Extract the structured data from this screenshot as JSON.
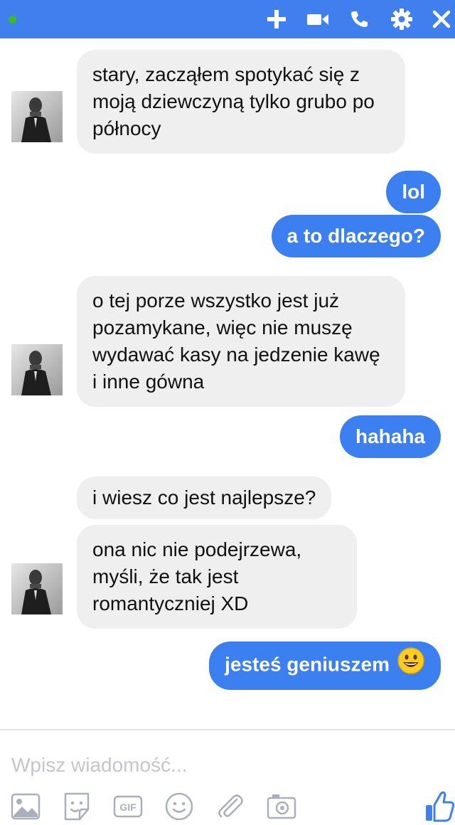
{
  "header": {
    "status": "online",
    "icons": [
      "add-icon",
      "video-call-icon",
      "phone-icon",
      "settings-icon",
      "close-icon"
    ],
    "accent_color": "#4080ee"
  },
  "conversation": {
    "messages": [
      {
        "from": "them",
        "text": "stary, zacząłem spotykać się z moją dziewczyną tylko grubo po północy"
      },
      {
        "from": "me",
        "text": "lol"
      },
      {
        "from": "me",
        "text": "a to dlaczego?"
      },
      {
        "from": "them",
        "text": "o tej porze wszystko jest już pozamykane, więc nie muszę wydawać kasy na jedzenie kawę i inne gówna"
      },
      {
        "from": "me",
        "text": "hahaha"
      },
      {
        "from": "them",
        "text": "i wiesz co jest najlepsze?"
      },
      {
        "from": "them",
        "text": "ona nic nie podejrzewa, myśli, że tak jest romantyczniej XD"
      },
      {
        "from": "me",
        "text": "jesteś geniuszem",
        "emoji": "grinning-face-emoji"
      }
    ]
  },
  "composer": {
    "placeholder": "Wpisz wiadomość...",
    "value": "",
    "tools": [
      "image-icon",
      "sticker-icon",
      "gif-icon",
      "emoji-icon",
      "attachment-icon",
      "camera-icon",
      "like-icon"
    ]
  }
}
